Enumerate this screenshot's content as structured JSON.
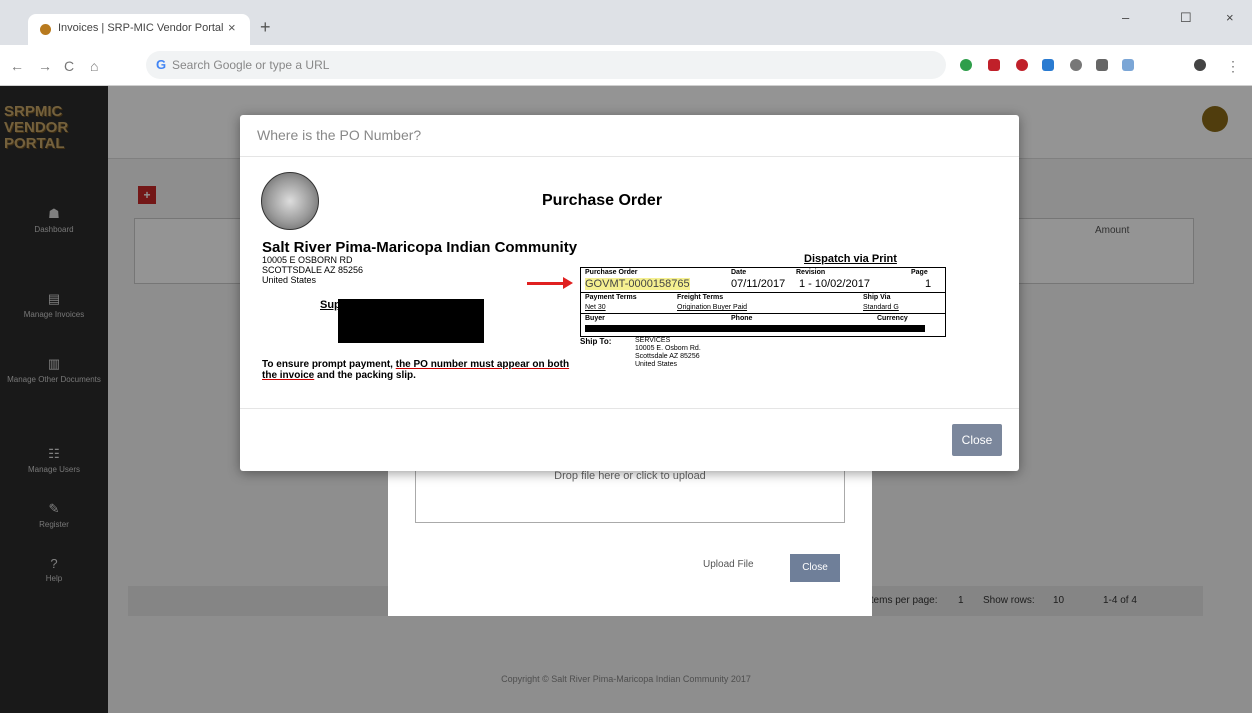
{
  "browser": {
    "tab_title": "Invoices | SRP-MIC Vendor Portal",
    "tab_close": "×",
    "new_tab": "+",
    "window_controls": [
      "–",
      "☐",
      "×"
    ],
    "nav": [
      "←",
      "→",
      "C",
      "⌂"
    ],
    "omnibox_icon": "G",
    "omnibox_placeholder": "Search Google or type a URL"
  },
  "portal": {
    "logo": "SRPMIC VENDOR PORTAL",
    "sidebar_items": [
      {
        "label": "Dashboard",
        "icon": "dashboard-icon",
        "glyph": "☗"
      },
      {
        "label": "Manage Invoices",
        "icon": "invoice-icon",
        "glyph": "▤"
      },
      {
        "label": "Manage Other Documents",
        "icon": "documents-icon",
        "glyph": "▥"
      },
      {
        "label": "Manage Users",
        "icon": "users-icon",
        "glyph": "☷"
      },
      {
        "label": "Register",
        "icon": "register-icon",
        "glyph": "✎"
      },
      {
        "label": "Help",
        "icon": "help-icon",
        "glyph": "?"
      }
    ],
    "add_button": "+",
    "table_header_amount": "Amount",
    "pagination": {
      "items_per_page": "Items per page:",
      "page": "1",
      "show_rows": "Show rows:",
      "rows": "10",
      "range": "1-4 of 4"
    },
    "copyright": "Copyright © Salt River Pima-Maricopa Indian Community 2017"
  },
  "upload_modal": {
    "dropzone_text": "Drop file here or click to upload",
    "upload_button": "Upload File",
    "close_button": "Close"
  },
  "modal": {
    "title": "Where is the PO Number?",
    "close_button": "Close",
    "document": {
      "heading": "Purchase Order",
      "org_name": "Salt River Pima-Maricopa Indian Community",
      "address": [
        "10005 E OSBORN RD",
        "SCOTTSDALE AZ 85256",
        "United States"
      ],
      "supplier_label": "Supplier:",
      "notice_prefix": "To ensure prompt payment, ",
      "notice_emph": "the PO number must appear on both the invoice",
      "notice_suffix": " and the packing slip.",
      "dispatch": "Dispatch via Print",
      "labels": {
        "po": "Purchase Order",
        "date": "Date",
        "revision": "Revision",
        "page": "Page",
        "payment_terms": "Payment Terms",
        "freight_terms": "Freight Terms",
        "ship_via": "Ship Via",
        "buyer": "Buyer",
        "phone": "Phone",
        "currency": "Currency",
        "ship_to": "Ship To:"
      },
      "values": {
        "po_number": "GOVMT-0000158765",
        "date": "07/11/2017",
        "revision": "1 - 10/02/2017",
        "page": "1",
        "payment_terms": "Net 30",
        "freight_terms": "Origination Buyer Paid",
        "ship_via": "Standard G"
      },
      "ship_to_lines": [
        "SERVICES",
        "10005 E. Osborn Rd.",
        "Scottsdale AZ 85256",
        "United States"
      ]
    }
  }
}
